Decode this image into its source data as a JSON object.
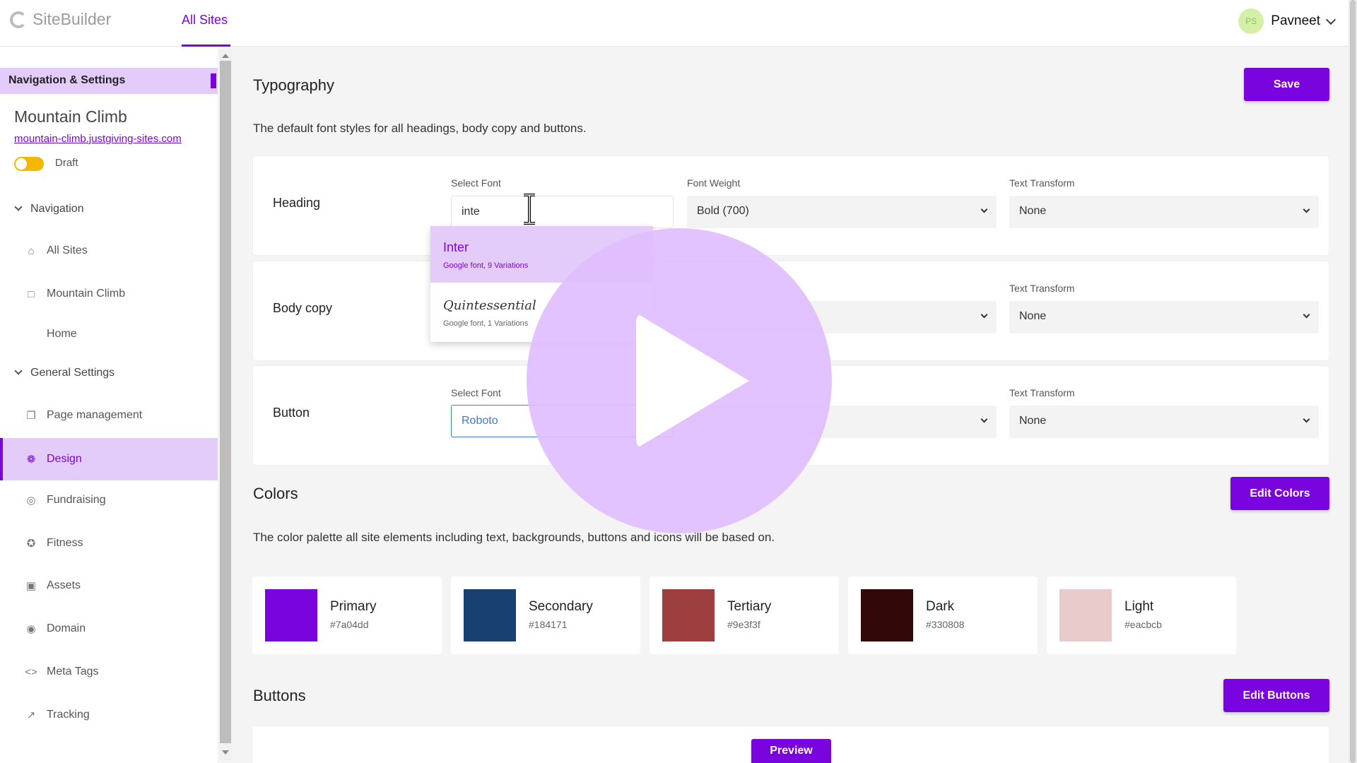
{
  "app": {
    "name": "SiteBuilder",
    "top_tab": "All Sites"
  },
  "user": {
    "initials": "PS",
    "name": "Pavneet"
  },
  "sidebar": {
    "header": "Navigation & Settings",
    "site_title": "Mountain Climb",
    "site_url": "mountain-climb.justgiving-sites.com",
    "status": "Draft",
    "sections": {
      "navigation": "Navigation",
      "general": "General Settings"
    },
    "items": [
      {
        "label": "All Sites",
        "icon": "home-icon"
      },
      {
        "label": "Mountain Climb",
        "icon": "file-icon"
      },
      {
        "label": "Home",
        "icon": ""
      },
      {
        "label": "Page management",
        "icon": "pages-icon"
      },
      {
        "label": "Design",
        "icon": "palette-icon"
      },
      {
        "label": "Fundraising",
        "icon": "coin-icon"
      },
      {
        "label": "Fitness",
        "icon": "runner-icon"
      },
      {
        "label": "Assets",
        "icon": "image-icon"
      },
      {
        "label": "Domain",
        "icon": "globe-icon"
      },
      {
        "label": "Meta Tags",
        "icon": "code-icon"
      },
      {
        "label": "Tracking",
        "icon": "trend-icon"
      }
    ]
  },
  "typography": {
    "title": "Typography",
    "save": "Save",
    "description": "The default font styles for all headings, body copy and buttons.",
    "labels": {
      "select_font": "Select Font",
      "font_weight": "Font Weight",
      "text_transform": "Text Transform"
    },
    "rows": [
      {
        "label": "Heading",
        "font": "inte",
        "weight": "Bold (700)",
        "transform": "None"
      },
      {
        "label": "Body copy",
        "transform": "None"
      },
      {
        "label": "Button",
        "font": "Roboto",
        "transform": "None"
      }
    ],
    "dropdown": [
      {
        "name": "Inter",
        "meta": "Google font, 9 Variations"
      },
      {
        "name": "Quintessential",
        "meta": "Google font, 1 Variations"
      }
    ]
  },
  "colors": {
    "title": "Colors",
    "edit": "Edit Colors",
    "description": "The color palette all site elements including text, backgrounds, buttons and icons will be based on.",
    "palette": [
      {
        "name": "Primary",
        "hex": "#7a04dd"
      },
      {
        "name": "Secondary",
        "hex": "#184171"
      },
      {
        "name": "Tertiary",
        "hex": "#9e3f3f"
      },
      {
        "name": "Dark",
        "hex": "#330808"
      },
      {
        "name": "Light",
        "hex": "#eacbcb"
      }
    ]
  },
  "buttons": {
    "title": "Buttons",
    "edit": "Edit Buttons",
    "preview": "Preview"
  },
  "theme": {
    "accent": "#7a04dd",
    "accent_light": "#e4ccfa"
  }
}
